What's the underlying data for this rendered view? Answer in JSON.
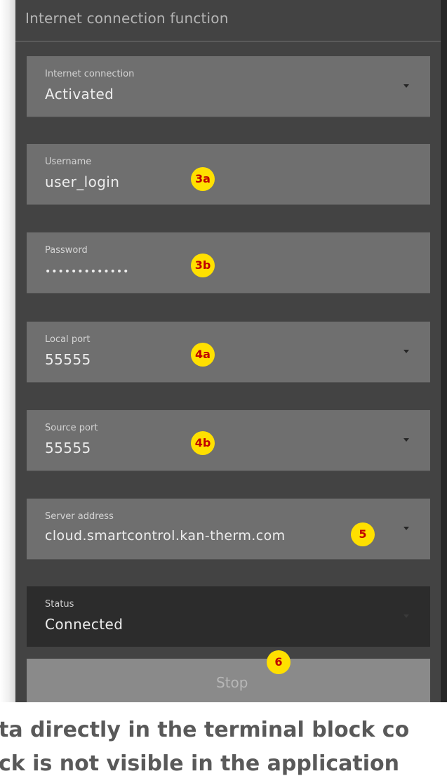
{
  "header": {
    "title": "Internet connection function"
  },
  "fields": [
    {
      "label": "Internet connection",
      "value": "Activated"
    },
    {
      "label": "Username",
      "value": "user_login"
    },
    {
      "label": "Password",
      "value": "•••••••••••••"
    },
    {
      "label": "Local port",
      "value": "55555"
    },
    {
      "label": "Source port",
      "value": "55555"
    },
    {
      "label": "Server address",
      "value": "cloud.smartcontrol.kan-therm.com"
    },
    {
      "label": "Status",
      "value": "Connected"
    }
  ],
  "stop_button": {
    "label": "Stop"
  },
  "callouts": [
    "3a",
    "3b",
    "4a",
    "4b",
    "5",
    "6"
  ],
  "caption": {
    "line1": "ta directly in the terminal block co",
    "line2": "ck is not visible in the application"
  },
  "colors": {
    "panel_bg": "#434343",
    "field_bg": "#6f6f6f",
    "status_bg": "#2c2c2c",
    "badge_fill": "#ffe000",
    "badge_text": "#c00000"
  }
}
